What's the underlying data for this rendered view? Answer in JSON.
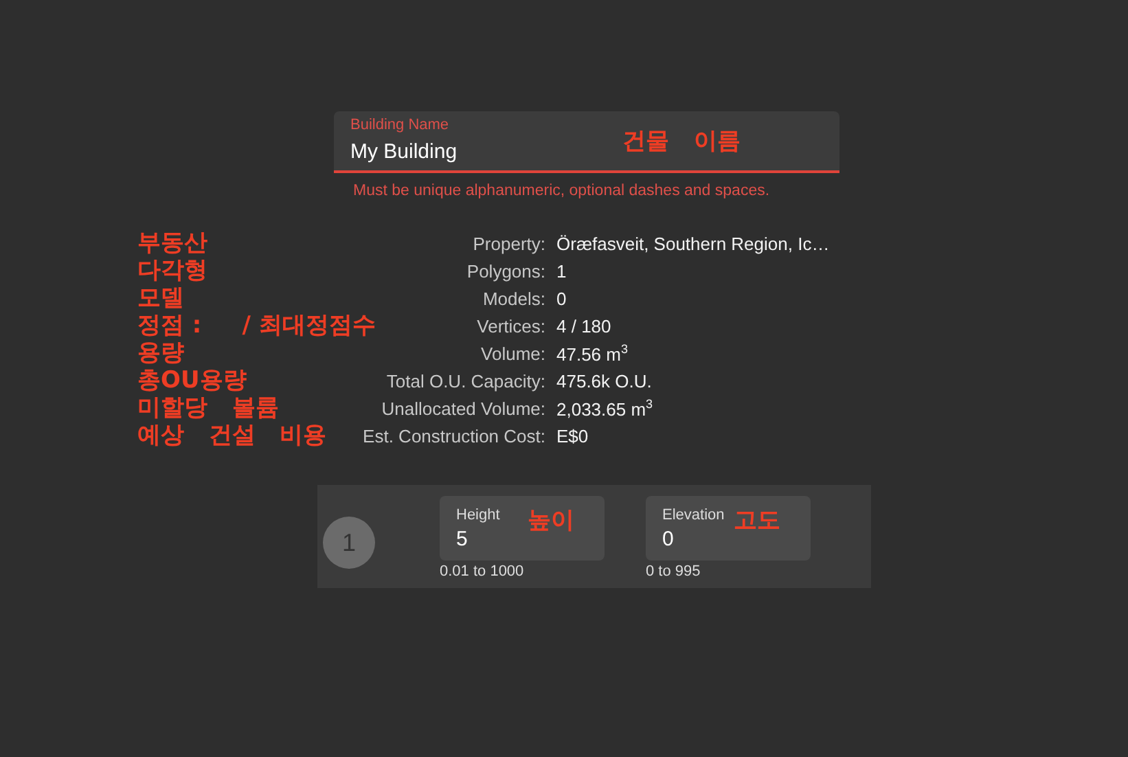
{
  "name_field": {
    "label": "Building Name",
    "value": "My Building",
    "annotation": "건물   이름",
    "hint": "Must be unique alphanumeric, optional dashes and spaces."
  },
  "details": [
    {
      "label": "Property:",
      "value": "Öræfasveit, Southern Region, Ic…",
      "annotation": "부동산"
    },
    {
      "label": "Polygons:",
      "value": "1",
      "annotation": "다각형"
    },
    {
      "label": "Models:",
      "value": "0",
      "annotation": "모델"
    },
    {
      "label": "Vertices:",
      "value": "4 / 180",
      "annotation": "정점 :     / 최대정점수"
    },
    {
      "label": "Volume:",
      "value": "47.56 m$^{3}$",
      "annotation": "용량"
    },
    {
      "label": "Total O.U. Capacity:",
      "value": "475.6k O.U.",
      "annotation": "총OU용량"
    },
    {
      "label": "Unallocated Volume:",
      "value": "2,033.65 m$^{3}$",
      "annotation": "미할당   볼륨"
    },
    {
      "label": "Est. Construction Cost:",
      "value": "E$0",
      "annotation": "예상   건설   비용"
    }
  ],
  "level_panel": {
    "badge": "1",
    "fields": [
      {
        "label": "Height",
        "value": "5",
        "range": "0.01 to 1000",
        "annotation": "높이"
      },
      {
        "label": "Elevation",
        "value": "0",
        "range": "0 to 995",
        "annotation": "고도"
      }
    ]
  }
}
